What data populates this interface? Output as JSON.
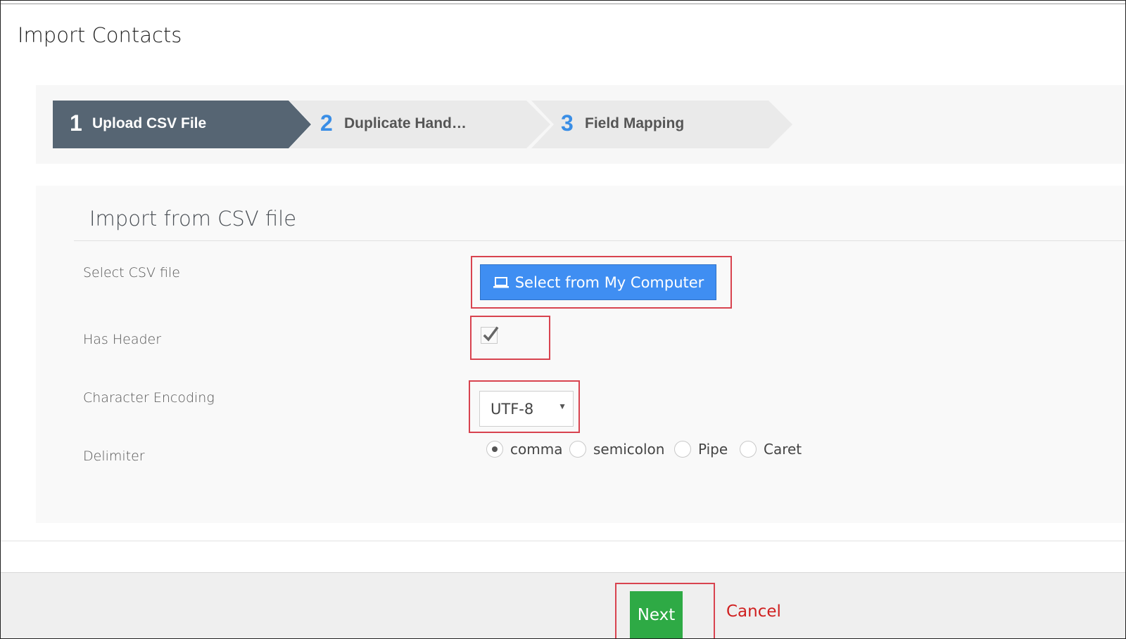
{
  "page": {
    "title": "Import Contacts"
  },
  "wizard": {
    "steps": [
      {
        "number": "1",
        "label": "Upload CSV File",
        "active": true
      },
      {
        "number": "2",
        "label": "Duplicate Hand…",
        "active": false
      },
      {
        "number": "3",
        "label": "Field Mapping",
        "active": false
      }
    ],
    "active_color": "#566573",
    "inactive_color": "#eaeaea",
    "number_color": "#3a8ee6"
  },
  "form": {
    "title": "Import from CSV file",
    "select_csv": {
      "label": "Select CSV file",
      "button_label": "Select from My Computer",
      "icon": "laptop-icon"
    },
    "has_header": {
      "label": "Has Header",
      "checked": true
    },
    "encoding": {
      "label": "Character Encoding",
      "value": "UTF-8"
    },
    "delimiter": {
      "label": "Delimiter",
      "options": [
        {
          "label": "comma",
          "checked": true
        },
        {
          "label": "semicolon",
          "checked": false
        },
        {
          "label": "Pipe",
          "checked": false
        },
        {
          "label": "Caret",
          "checked": false
        }
      ]
    }
  },
  "footer": {
    "next_label": "Next",
    "cancel_label": "Cancel"
  },
  "colors": {
    "primary": "#3f8ef2",
    "success": "#2eaa45",
    "danger": "#d02020",
    "highlight": "#d8434f"
  }
}
